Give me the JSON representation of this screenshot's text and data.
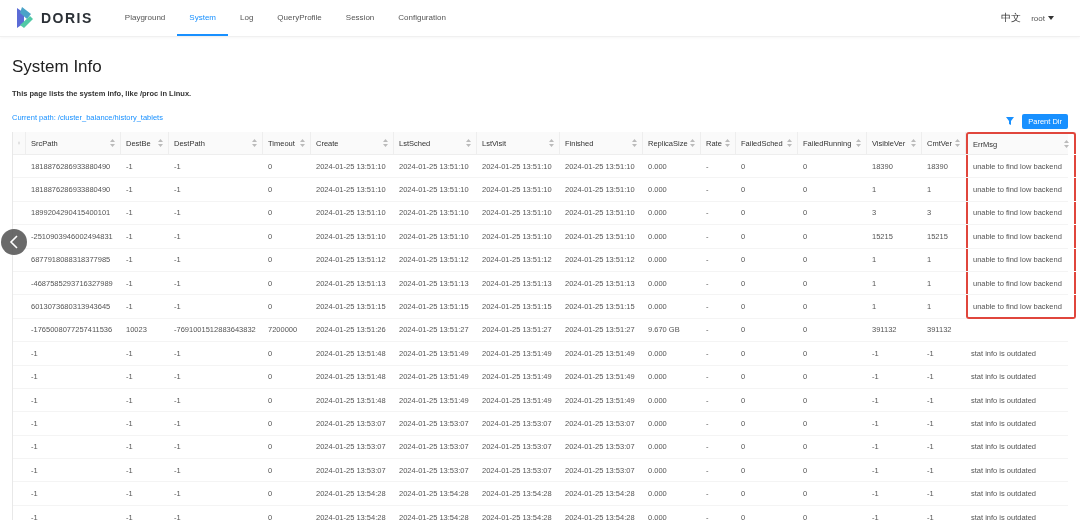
{
  "nav": {
    "brand": "DORIS",
    "items": [
      {
        "label": "Playground",
        "selected": false
      },
      {
        "label": "System",
        "selected": true
      },
      {
        "label": "Log",
        "selected": false
      },
      {
        "label": "QueryProfile",
        "selected": false
      },
      {
        "label": "Session",
        "selected": false
      },
      {
        "label": "Configuration",
        "selected": false
      }
    ],
    "language": "中文",
    "user": "root"
  },
  "page": {
    "title": "System Info",
    "description": "This page lists the system info, like /proc in Linux.",
    "current_path": "Current path: /cluster_balance/history_tablets",
    "parent_button": "Parent Dir"
  },
  "table": {
    "columns": [
      {
        "label": "SrcPath",
        "highlighted": false
      },
      {
        "label": "DestBe",
        "highlighted": false
      },
      {
        "label": "DestPath",
        "highlighted": false
      },
      {
        "label": "Timeout",
        "highlighted": false
      },
      {
        "label": "Create",
        "highlighted": false
      },
      {
        "label": "LstSched",
        "highlighted": false
      },
      {
        "label": "LstVisit",
        "highlighted": false
      },
      {
        "label": "Finished",
        "highlighted": false
      },
      {
        "label": "ReplicaSize",
        "highlighted": false
      },
      {
        "label": "Rate",
        "highlighted": false
      },
      {
        "label": "FailedSched",
        "highlighted": false
      },
      {
        "label": "FailedRunning",
        "highlighted": false
      },
      {
        "label": "VisibleVer",
        "highlighted": false
      },
      {
        "label": "CmtVer",
        "highlighted": false
      },
      {
        "label": "ErrMsg",
        "highlighted": true
      }
    ],
    "rows": [
      {
        "highlighted": true,
        "cells": [
          "1818876286933880490",
          "-1",
          "-1",
          "0",
          "2024-01-25 13:51:10",
          "2024-01-25 13:51:10",
          "2024-01-25 13:51:10",
          "2024-01-25 13:51:10",
          "0.000",
          "-",
          "0",
          "0",
          "18390",
          "18390",
          "unable to find low backend"
        ]
      },
      {
        "highlighted": true,
        "cells": [
          "1818876286933880490",
          "-1",
          "-1",
          "0",
          "2024-01-25 13:51:10",
          "2024-01-25 13:51:10",
          "2024-01-25 13:51:10",
          "2024-01-25 13:51:10",
          "0.000",
          "-",
          "0",
          "0",
          "1",
          "1",
          "unable to find low backend"
        ]
      },
      {
        "highlighted": true,
        "cells": [
          "1899204290415400101",
          "-1",
          "-1",
          "0",
          "2024-01-25 13:51:10",
          "2024-01-25 13:51:10",
          "2024-01-25 13:51:10",
          "2024-01-25 13:51:10",
          "0.000",
          "-",
          "0",
          "0",
          "3",
          "3",
          "unable to find low backend"
        ]
      },
      {
        "highlighted": true,
        "cells": [
          "-2510903946002494831",
          "-1",
          "-1",
          "0",
          "2024-01-25 13:51:10",
          "2024-01-25 13:51:10",
          "2024-01-25 13:51:10",
          "2024-01-25 13:51:10",
          "0.000",
          "-",
          "0",
          "0",
          "15215",
          "15215",
          "unable to find low backend"
        ]
      },
      {
        "highlighted": true,
        "cells": [
          "6877918088318377985",
          "-1",
          "-1",
          "0",
          "2024-01-25 13:51:12",
          "2024-01-25 13:51:12",
          "2024-01-25 13:51:12",
          "2024-01-25 13:51:12",
          "0.000",
          "-",
          "0",
          "0",
          "1",
          "1",
          "unable to find low backend"
        ]
      },
      {
        "highlighted": true,
        "cells": [
          "-4687585293716327989",
          "-1",
          "-1",
          "0",
          "2024-01-25 13:51:13",
          "2024-01-25 13:51:13",
          "2024-01-25 13:51:13",
          "2024-01-25 13:51:13",
          "0.000",
          "-",
          "0",
          "0",
          "1",
          "1",
          "unable to find low backend"
        ]
      },
      {
        "highlighted": true,
        "cells": [
          "6013073680313943645",
          "-1",
          "-1",
          "0",
          "2024-01-25 13:51:15",
          "2024-01-25 13:51:15",
          "2024-01-25 13:51:15",
          "2024-01-25 13:51:15",
          "0.000",
          "-",
          "0",
          "0",
          "1",
          "1",
          "unable to find low backend"
        ]
      },
      {
        "highlighted": false,
        "cells": [
          "-1765008077257411536",
          "10023",
          "-7691001512883643832",
          "7200000",
          "2024-01-25 13:51:26",
          "2024-01-25 13:51:27",
          "2024-01-25 13:51:27",
          "2024-01-25 13:51:27",
          "9.670 GB",
          "-",
          "0",
          "0",
          "391132",
          "391132",
          null
        ]
      },
      {
        "highlighted": false,
        "cells": [
          "-1",
          "-1",
          "-1",
          "0",
          "2024-01-25 13:51:48",
          "2024-01-25 13:51:49",
          "2024-01-25 13:51:49",
          "2024-01-25 13:51:49",
          "0.000",
          "-",
          "0",
          "0",
          "-1",
          "-1",
          "stat info is outdated"
        ]
      },
      {
        "highlighted": false,
        "cells": [
          "-1",
          "-1",
          "-1",
          "0",
          "2024-01-25 13:51:48",
          "2024-01-25 13:51:49",
          "2024-01-25 13:51:49",
          "2024-01-25 13:51:49",
          "0.000",
          "-",
          "0",
          "0",
          "-1",
          "-1",
          "stat info is outdated"
        ]
      },
      {
        "highlighted": false,
        "cells": [
          "-1",
          "-1",
          "-1",
          "0",
          "2024-01-25 13:51:48",
          "2024-01-25 13:51:49",
          "2024-01-25 13:51:49",
          "2024-01-25 13:51:49",
          "0.000",
          "-",
          "0",
          "0",
          "-1",
          "-1",
          "stat info is outdated"
        ]
      },
      {
        "highlighted": false,
        "cells": [
          "-1",
          "-1",
          "-1",
          "0",
          "2024-01-25 13:53:07",
          "2024-01-25 13:53:07",
          "2024-01-25 13:53:07",
          "2024-01-25 13:53:07",
          "0.000",
          "-",
          "0",
          "0",
          "-1",
          "-1",
          "stat info is outdated"
        ]
      },
      {
        "highlighted": false,
        "cells": [
          "-1",
          "-1",
          "-1",
          "0",
          "2024-01-25 13:53:07",
          "2024-01-25 13:53:07",
          "2024-01-25 13:53:07",
          "2024-01-25 13:53:07",
          "0.000",
          "-",
          "0",
          "0",
          "-1",
          "-1",
          "stat info is outdated"
        ]
      },
      {
        "highlighted": false,
        "cells": [
          "-1",
          "-1",
          "-1",
          "0",
          "2024-01-25 13:53:07",
          "2024-01-25 13:53:07",
          "2024-01-25 13:53:07",
          "2024-01-25 13:53:07",
          "0.000",
          "-",
          "0",
          "0",
          "-1",
          "-1",
          "stat info is outdated"
        ]
      },
      {
        "highlighted": false,
        "cells": [
          "-1",
          "-1",
          "-1",
          "0",
          "2024-01-25 13:54:28",
          "2024-01-25 13:54:28",
          "2024-01-25 13:54:28",
          "2024-01-25 13:54:28",
          "0.000",
          "-",
          "0",
          "0",
          "-1",
          "-1",
          "stat info is outdated"
        ]
      },
      {
        "highlighted": false,
        "cells": [
          "-1",
          "-1",
          "-1",
          "0",
          "2024-01-25 13:54:28",
          "2024-01-25 13:54:28",
          "2024-01-25 13:54:28",
          "2024-01-25 13:54:28",
          "0.000",
          "-",
          "0",
          "0",
          "-1",
          "-1",
          "stat info is outdated"
        ]
      }
    ]
  }
}
